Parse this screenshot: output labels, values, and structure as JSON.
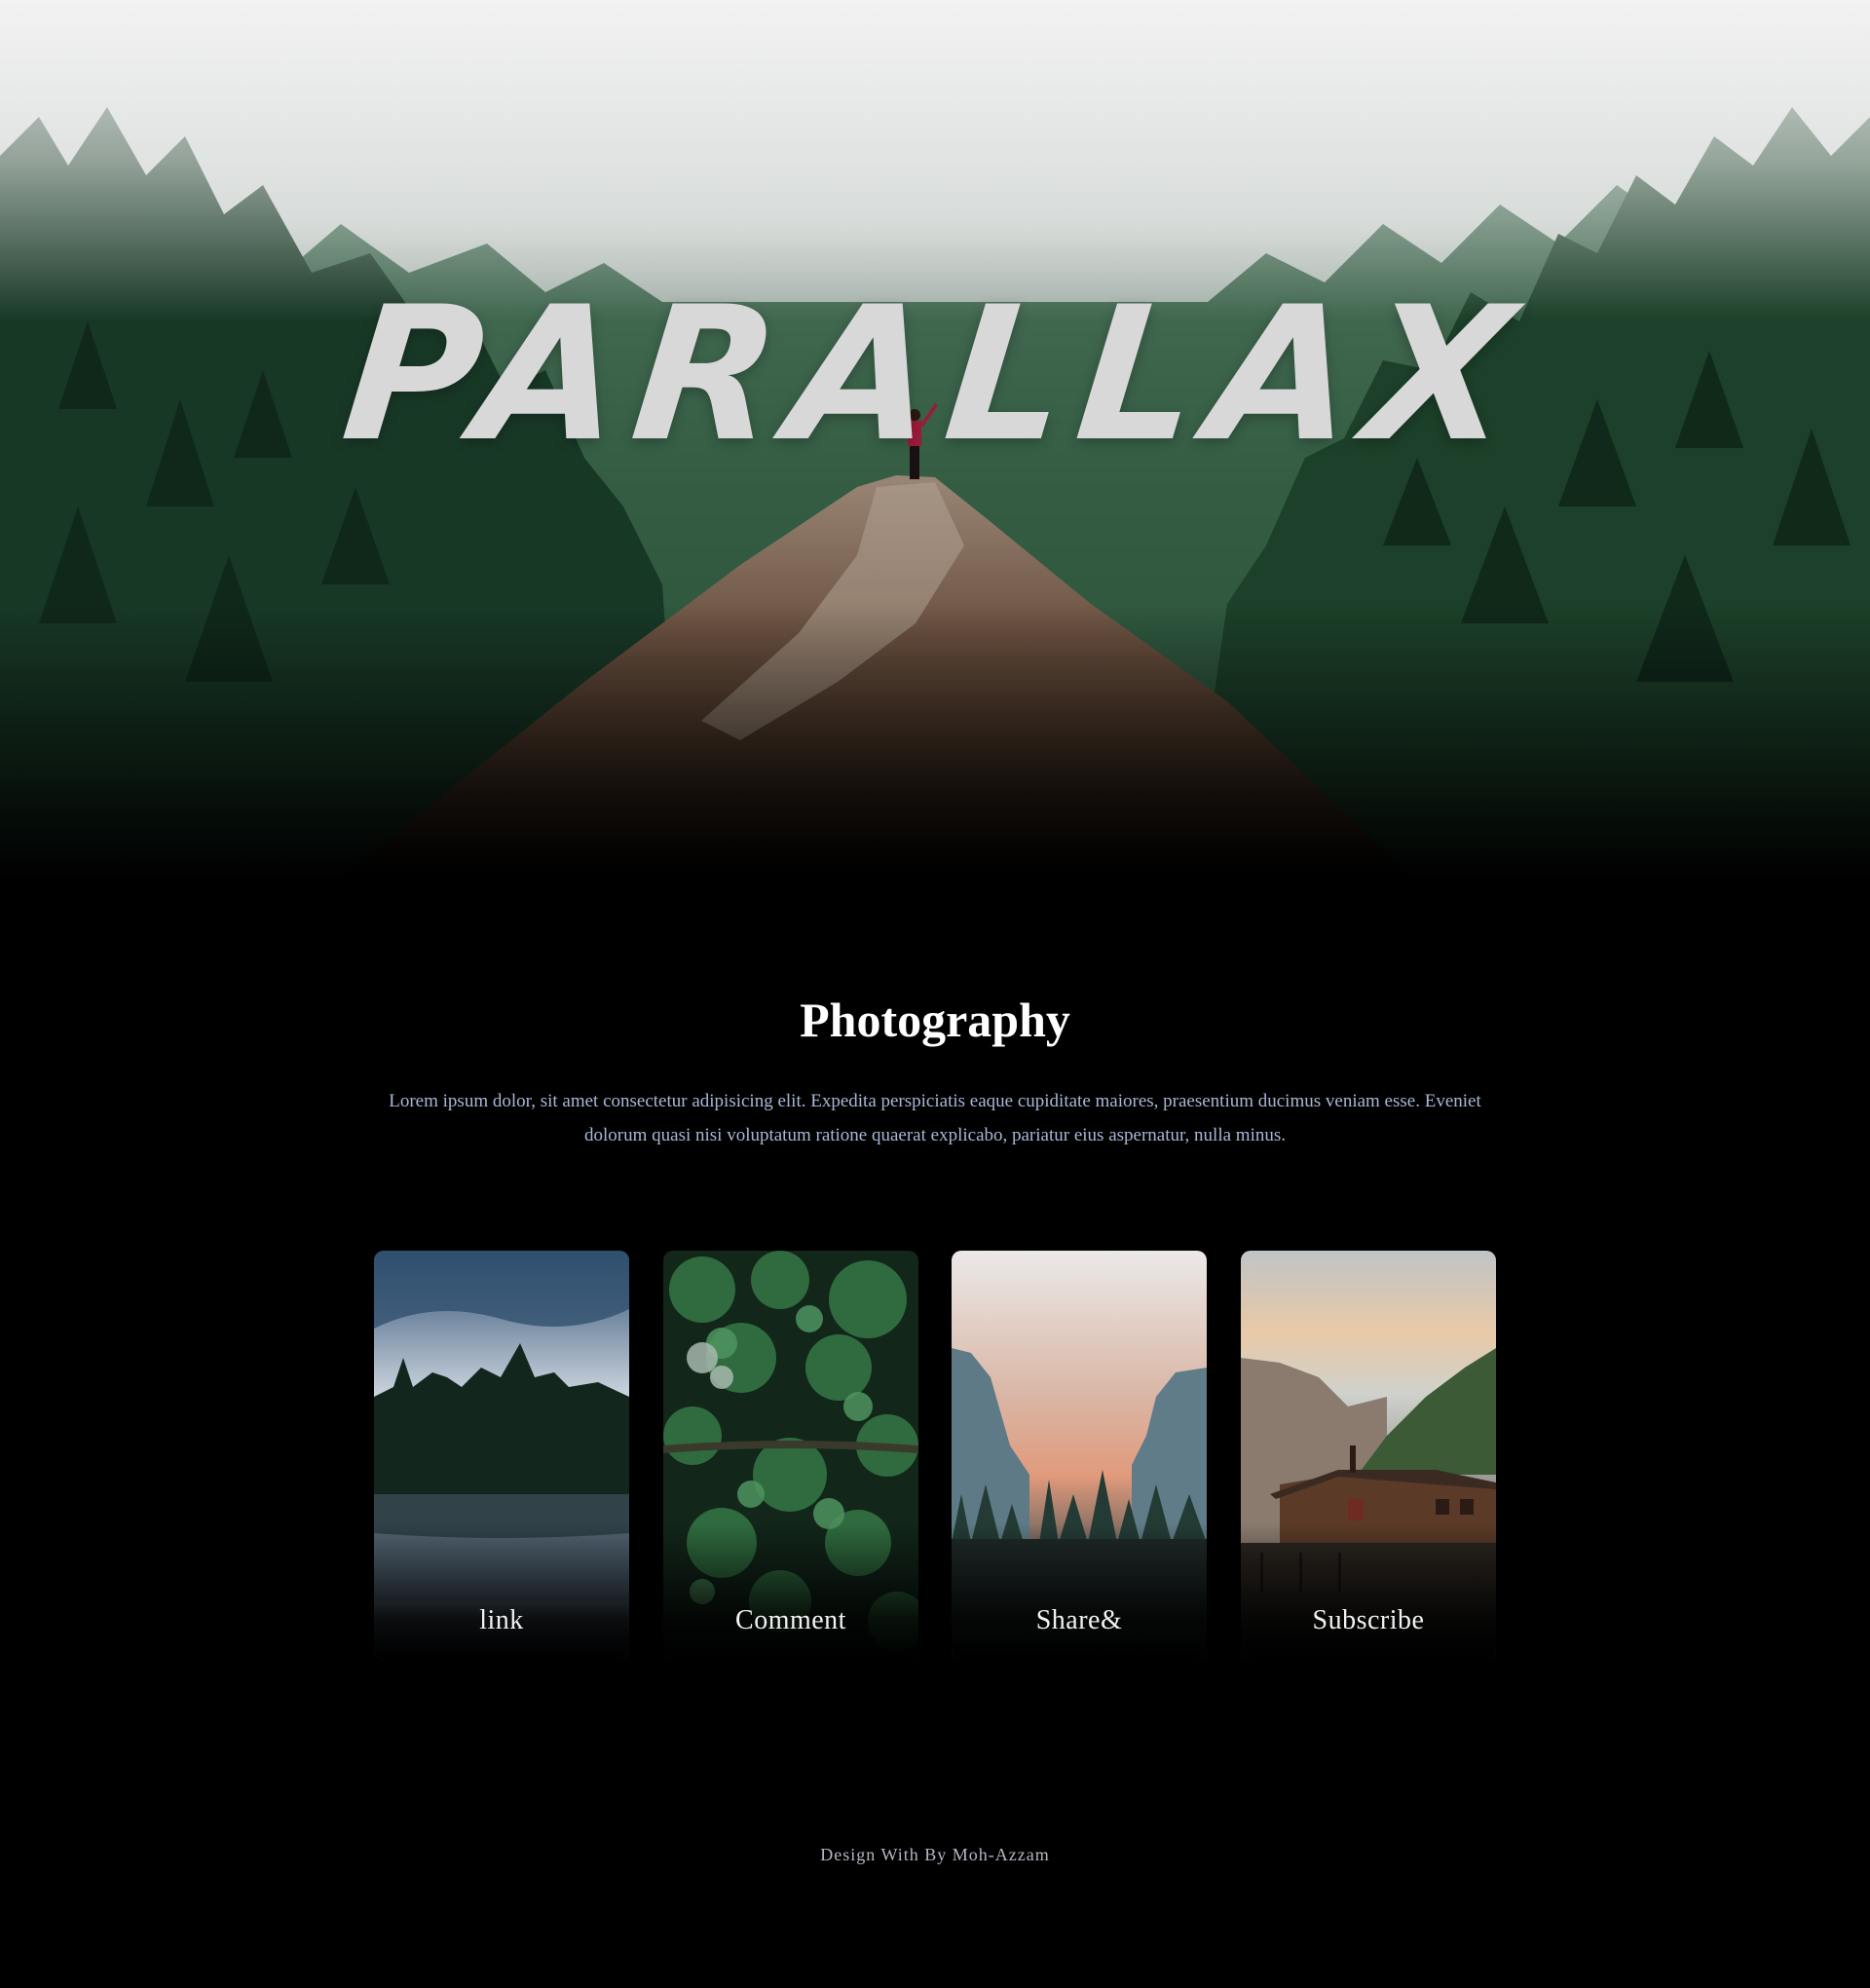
{
  "hero": {
    "title": "PARALLAX"
  },
  "section": {
    "heading": "Photography",
    "description": "Lorem ipsum dolor, sit amet consectetur adipisicing elit. Expedita perspiciatis eaque cupiditate maiores, praesentium ducimus veniam esse. Eveniet dolorum quasi nisi voluptatum ratione quaerat explicabo, pariatur eius aspernatur, nulla minus."
  },
  "cards": [
    {
      "label": "link"
    },
    {
      "label": "Comment"
    },
    {
      "label": "Share&"
    },
    {
      "label": "Subscribe"
    }
  ],
  "footer": {
    "text": "Design With By Moh-Azzam"
  },
  "colors": {
    "background": "#000000",
    "text_muted": "#a9b7d6",
    "title": "#d8d8d8"
  }
}
